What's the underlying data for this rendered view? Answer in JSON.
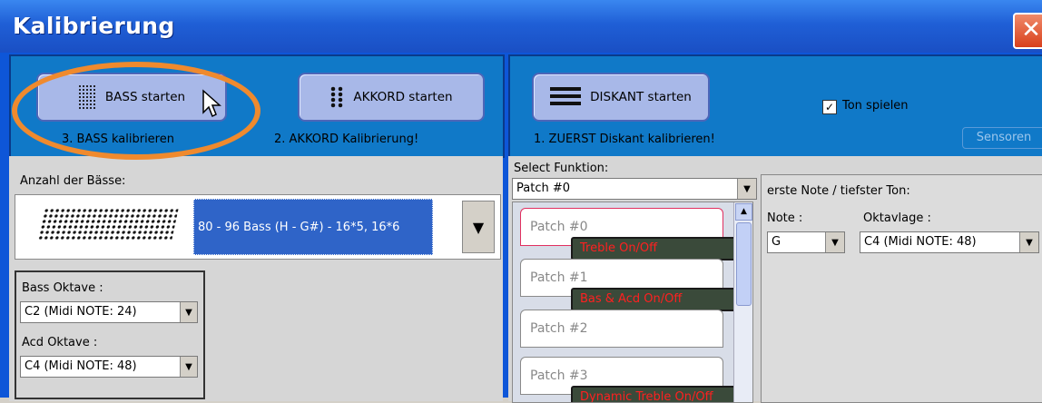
{
  "window": {
    "title": "Kalibrierung",
    "close_glyph": "✕"
  },
  "calibration": {
    "bass_button": "BASS starten",
    "bass_caption": "3. BASS kalibrieren",
    "akkord_button": "AKKORD starten",
    "akkord_caption": "2. AKKORD Kalibrierung!",
    "diskant_button": "DISKANT starten",
    "diskant_caption": "1. ZUERST Diskant kalibrieren!",
    "ton_spielen": "Ton spielen",
    "sensoren_button": "Sensoren"
  },
  "bass": {
    "anzahl_label": "Anzahl der Bässe:",
    "selected": "80 - 96 Bass (H - G#)  - 16*5, 16*6",
    "bass_oktave_label": "Bass Oktave :",
    "bass_oktave_value": "C2  (Midi NOTE: 24)",
    "acd_oktave_label": "Acd Oktave :",
    "acd_oktave_value": "C4  (Midi NOTE: 48)"
  },
  "funktion": {
    "label": "Select Funktion:",
    "value": "Patch #0",
    "patches": [
      "Patch #0",
      "Patch #1",
      "Patch #2",
      "Patch #3"
    ],
    "tags": [
      "Treble  On/Off",
      "Bas & Acd On/Off",
      "Dynamic Treble On/Off"
    ]
  },
  "note": {
    "header": "erste Note / tiefster Ton:",
    "note_label": "Note :",
    "note_value": "G",
    "oktavlage_label": "Oktavlage :",
    "oktavlage_value": "C4  (Midi NOTE: 48)"
  },
  "colors": {
    "accent_ring": "#ef8a2e",
    "tag_text": "#ff2020",
    "selection": "#2f64c8"
  }
}
